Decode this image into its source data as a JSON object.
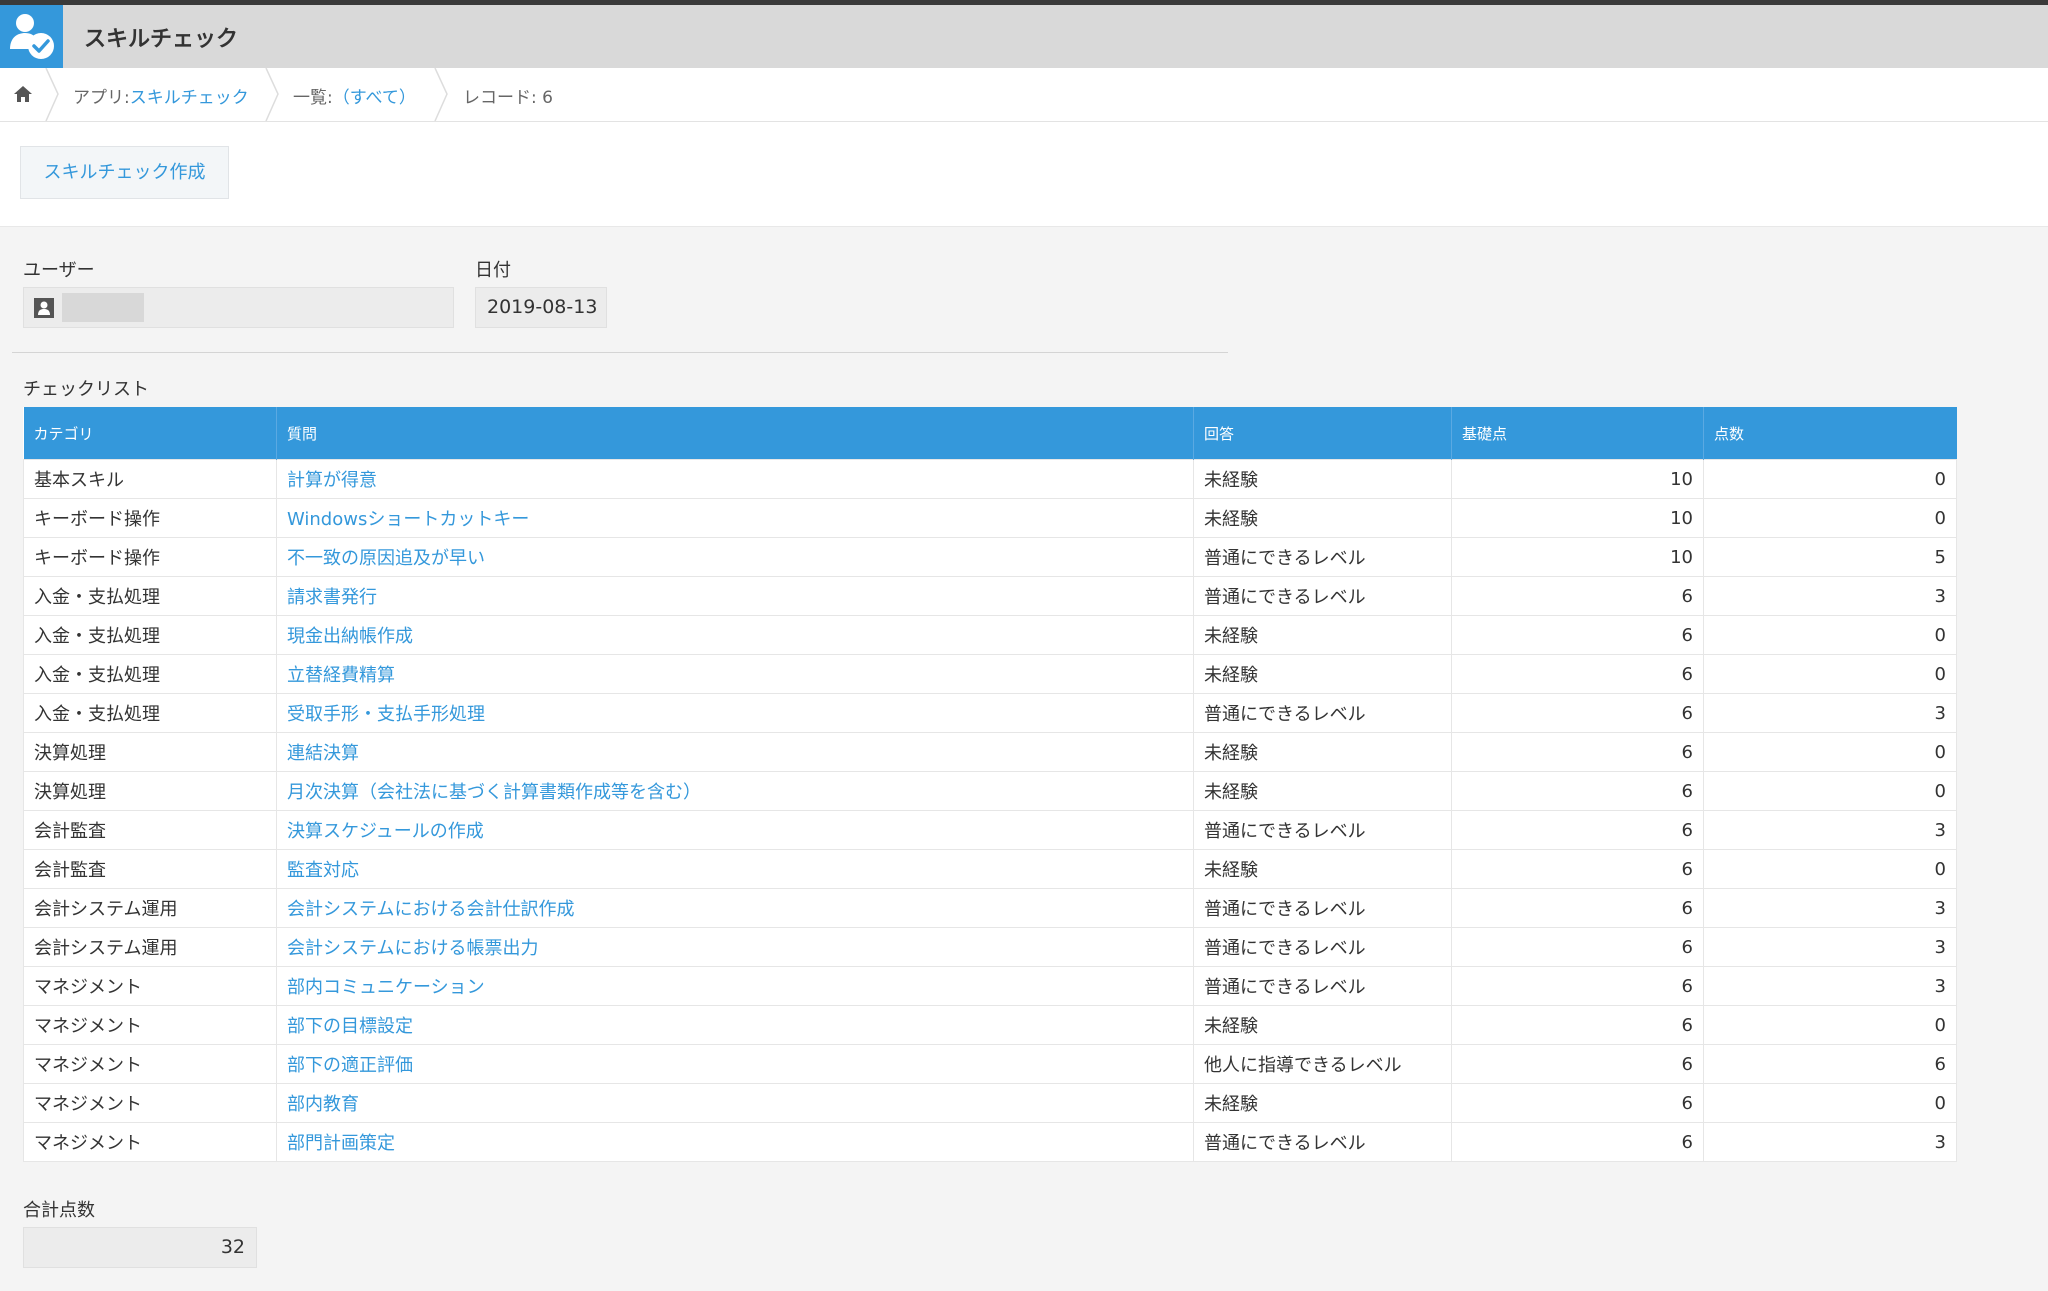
{
  "app": {
    "title": "スキルチェック",
    "icon": "user-check-icon",
    "accent": "#3498db"
  },
  "breadcrumb": {
    "app_prefix": "アプリ:",
    "app_name": "スキルチェック",
    "view_prefix": "一覧:",
    "view_name": "（すべて）",
    "record": "レコード: 6"
  },
  "toolbar": {
    "create_label": "スキルチェック作成"
  },
  "form": {
    "user_label": "ユーザー",
    "date_label": "日付",
    "date_value": "2019-08-13",
    "checklist_label": "チェックリスト",
    "total_label": "合計点数",
    "total_value": "32"
  },
  "table": {
    "headers": [
      "カテゴリ",
      "質問",
      "回答",
      "基礎点",
      "点数"
    ],
    "rows": [
      [
        "基本スキル",
        "計算が得意",
        "未経験",
        "10",
        "0"
      ],
      [
        "キーボード操作",
        "Windowsショートカットキー",
        "未経験",
        "10",
        "0"
      ],
      [
        "キーボード操作",
        "不一致の原因追及が早い",
        "普通にできるレベル",
        "10",
        "5"
      ],
      [
        "入金・支払処理",
        "請求書発行",
        "普通にできるレベル",
        "6",
        "3"
      ],
      [
        "入金・支払処理",
        "現金出納帳作成",
        "未経験",
        "6",
        "0"
      ],
      [
        "入金・支払処理",
        "立替経費精算",
        "未経験",
        "6",
        "0"
      ],
      [
        "入金・支払処理",
        "受取手形・支払手形処理",
        "普通にできるレベル",
        "6",
        "3"
      ],
      [
        "決算処理",
        "連結決算",
        "未経験",
        "6",
        "0"
      ],
      [
        "決算処理",
        "月次決算（会社法に基づく計算書類作成等を含む）",
        "未経験",
        "6",
        "0"
      ],
      [
        "会計監査",
        "決算スケジュールの作成",
        "普通にできるレベル",
        "6",
        "3"
      ],
      [
        "会計監査",
        "監査対応",
        "未経験",
        "6",
        "0"
      ],
      [
        "会計システム運用",
        "会計システムにおける会計仕訳作成",
        "普通にできるレベル",
        "6",
        "3"
      ],
      [
        "会計システム運用",
        "会計システムにおける帳票出力",
        "普通にできるレベル",
        "6",
        "3"
      ],
      [
        "マネジメント",
        "部内コミュニケーション",
        "普通にできるレベル",
        "6",
        "3"
      ],
      [
        "マネジメント",
        "部下の目標設定",
        "未経験",
        "6",
        "0"
      ],
      [
        "マネジメント",
        "部下の適正評価",
        "他人に指導できるレベル",
        "6",
        "6"
      ],
      [
        "マネジメント",
        "部内教育",
        "未経験",
        "6",
        "0"
      ],
      [
        "マネジメント",
        "部門計画策定",
        "普通にできるレベル",
        "6",
        "3"
      ]
    ]
  }
}
